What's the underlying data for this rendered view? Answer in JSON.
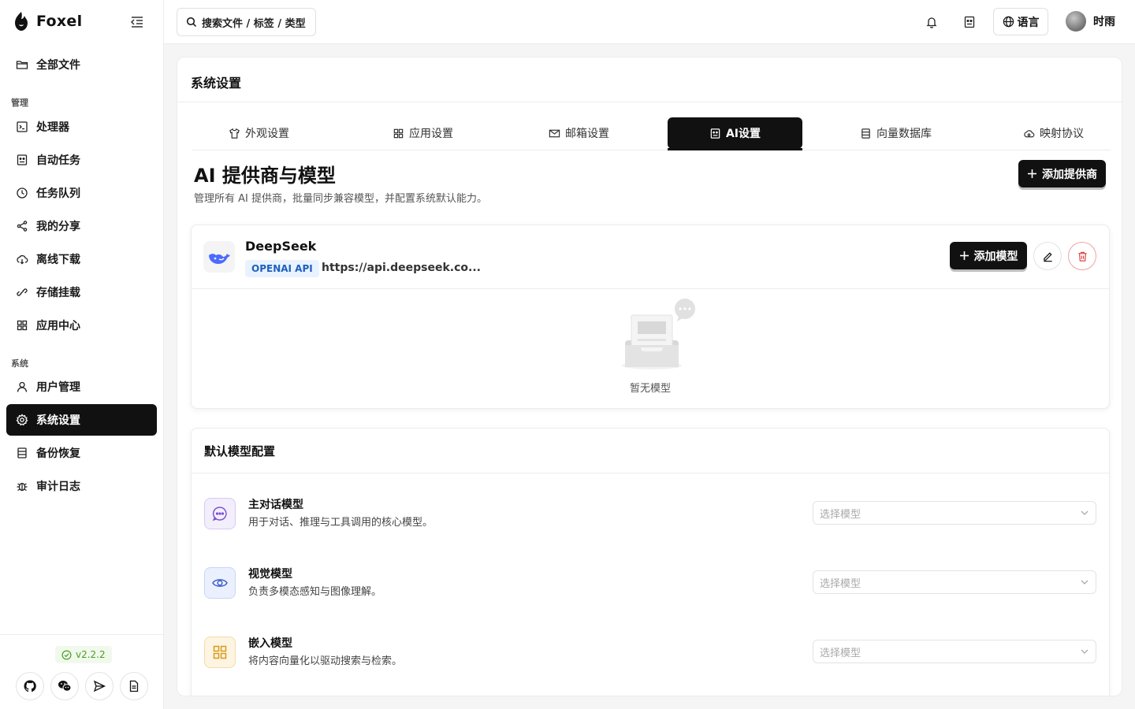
{
  "app": {
    "name": "Foxel"
  },
  "sidebar": {
    "top_items": [
      {
        "label": "全部文件",
        "icon": "folder-icon"
      }
    ],
    "sections": [
      {
        "title": "管理",
        "items": [
          {
            "label": "处理器",
            "icon": "terminal-icon"
          },
          {
            "label": "自动任务",
            "icon": "robot-icon"
          },
          {
            "label": "任务队列",
            "icon": "clock-icon"
          },
          {
            "label": "我的分享",
            "icon": "share-icon"
          },
          {
            "label": "离线下载",
            "icon": "cloud-download-icon"
          },
          {
            "label": "存储挂载",
            "icon": "link-icon"
          },
          {
            "label": "应用中心",
            "icon": "grid-icon"
          }
        ]
      },
      {
        "title": "系统",
        "items": [
          {
            "label": "用户管理",
            "icon": "user-icon"
          },
          {
            "label": "系统设置",
            "icon": "gear-icon",
            "active": true
          },
          {
            "label": "备份恢复",
            "icon": "database-icon"
          },
          {
            "label": "审计日志",
            "icon": "bug-icon"
          }
        ]
      }
    ],
    "version": "v2.2.2"
  },
  "header": {
    "search_placeholder": "搜索文件 / 标签 / 类型",
    "language_label": "语言",
    "user_name": "时雨"
  },
  "page": {
    "title": "系统设置",
    "tabs": [
      {
        "label": "外观设置",
        "icon": "shirt-icon"
      },
      {
        "label": "应用设置",
        "icon": "apps-icon"
      },
      {
        "label": "邮箱设置",
        "icon": "mail-icon"
      },
      {
        "label": "AI设置",
        "icon": "robot-icon",
        "active": true
      },
      {
        "label": "向量数据库",
        "icon": "database-icon"
      },
      {
        "label": "映射协议",
        "icon": "cloud-sync-icon"
      }
    ]
  },
  "ai": {
    "section_title": "AI 提供商与模型",
    "section_subtitle": "管理所有 AI 提供商，批量同步兼容模型，并配置系统默认能力。",
    "add_provider_label": "添加提供商",
    "provider": {
      "name": "DeepSeek",
      "badge": "OPENAI API",
      "url": "https://api.deepseek.co...",
      "add_model_label": "添加模型",
      "empty_text": "暂无模型"
    },
    "defaults": {
      "title": "默认模型配置",
      "rows": [
        {
          "name": "主对话模型",
          "desc": "用于对话、推理与工具调用的核心模型。",
          "placeholder": "选择模型",
          "icon": "chat-icon",
          "color": "#7b4fd1",
          "bg": "#f3eefc"
        },
        {
          "name": "视觉模型",
          "desc": "负责多模态感知与图像理解。",
          "placeholder": "选择模型",
          "icon": "eye-icon",
          "color": "#3c5ec9",
          "bg": "#eaf0fd"
        },
        {
          "name": "嵌入模型",
          "desc": "将内容向量化以驱动搜索与检索。",
          "placeholder": "选择模型",
          "icon": "grid-icon",
          "color": "#d99a1a",
          "bg": "#fdf4e2"
        }
      ]
    }
  }
}
